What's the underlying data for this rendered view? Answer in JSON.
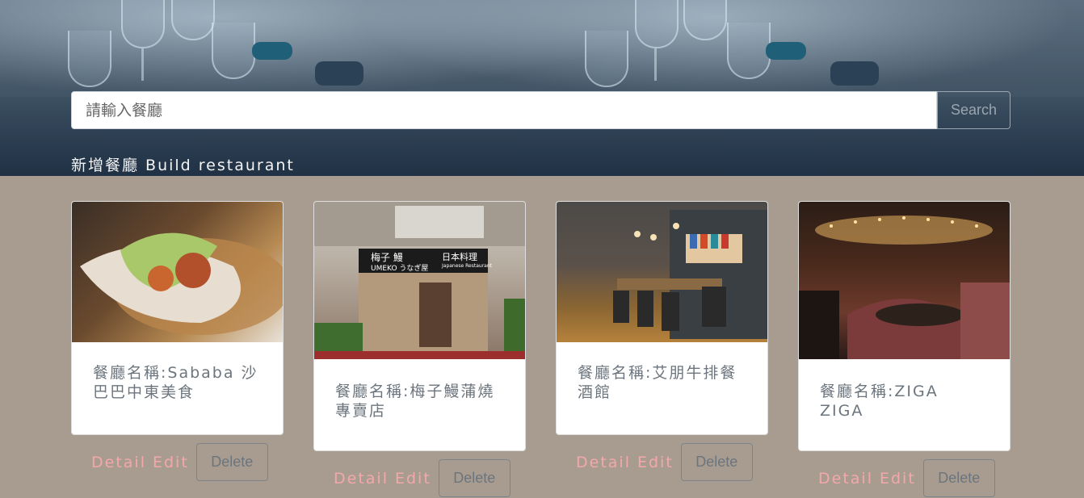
{
  "search": {
    "placeholder": "請輸入餐廳",
    "button_label": "Search"
  },
  "header": {
    "build_link": "新增餐廳 Build restaurant"
  },
  "restaurants": [
    {
      "name": "餐廳名稱:Sababa 沙巴巴中東美食",
      "image_icon": "pita-food-photo"
    },
    {
      "name": "餐廳名稱:梅子鰻蒲燒專賣店",
      "image_icon": "storefront-photo",
      "sign_main": "梅子 鰻",
      "sign_sub": "UMEKO うなぎ屋",
      "sign_side": "日本料理",
      "sign_en": "Japanese Restaurant"
    },
    {
      "name": "餐廳名稱:艾朋牛排餐酒館",
      "image_icon": "dining-room-photo"
    },
    {
      "name": "餐廳名稱:ZIGA ZIGA",
      "image_icon": "bar-interior-photo"
    }
  ],
  "actions": {
    "detail_label": "Detail",
    "edit_label": "Edit",
    "delete_label": "Delete"
  },
  "colors": {
    "page_bg": "#a89c90",
    "link_pink": "#f4a7ab",
    "title_gray": "#6c757d"
  }
}
